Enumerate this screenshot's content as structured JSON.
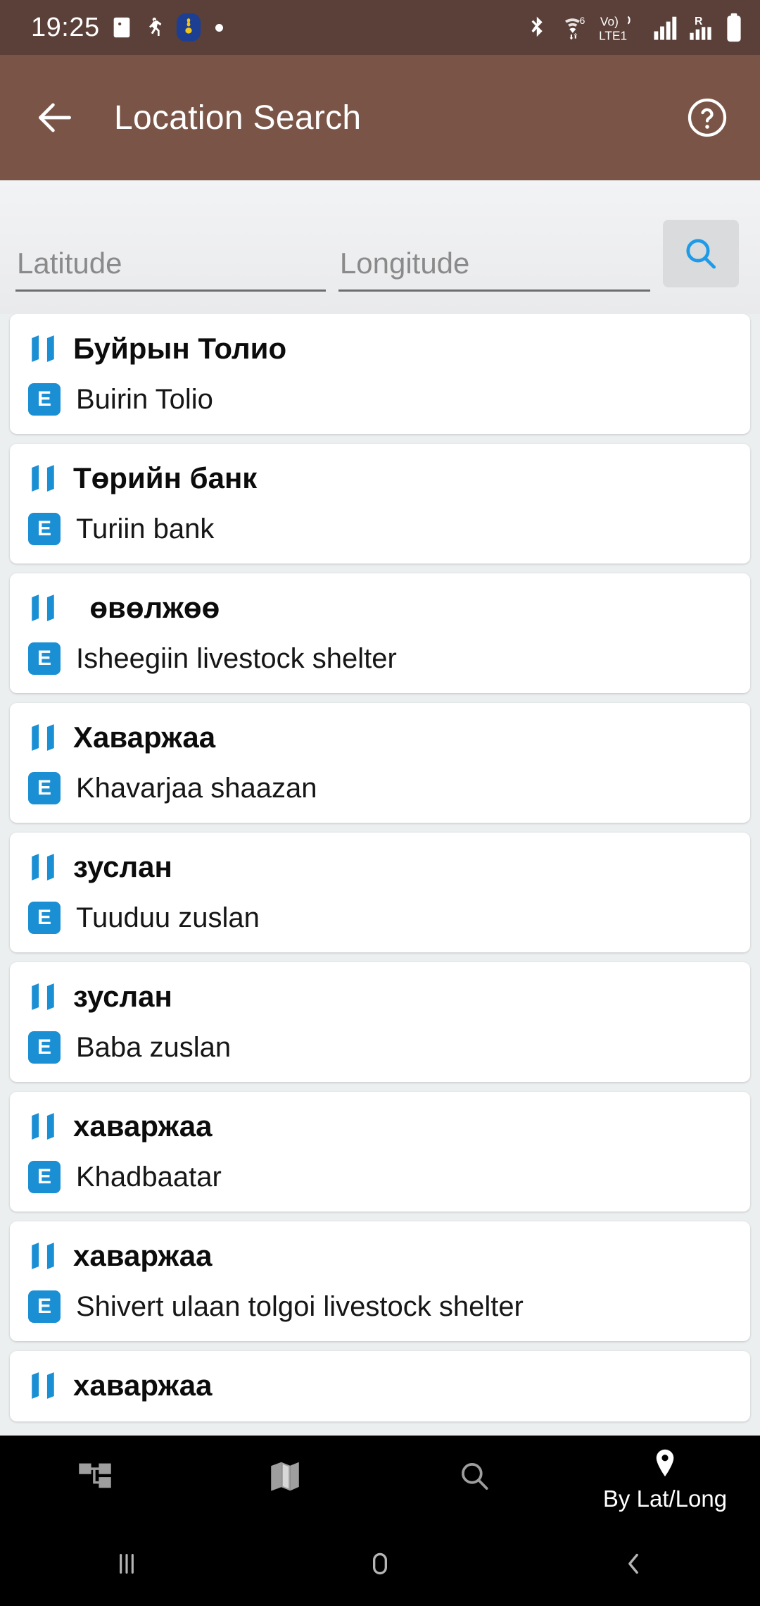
{
  "status_bar": {
    "time": "19:25",
    "left_icons": [
      "image-icon",
      "running-person-icon",
      "mongolia-app-icon",
      "dot-indicator"
    ],
    "right_icons": [
      "bluetooth-icon",
      "wifi-6-icon",
      "volte-lte1-icon",
      "signal-bars-icon",
      "roaming-signal-icon",
      "battery-icon"
    ],
    "wifi_label": "6",
    "volte_label": "Vo)",
    "network_label": "LTE1",
    "roaming_label": "R",
    "background_color": "#5a4039"
  },
  "app_bar": {
    "title": "Location Search",
    "back_label": "back-arrow",
    "help_label": "help-circle",
    "background_color": "#7a5547"
  },
  "search": {
    "latitude": {
      "placeholder": "Latitude",
      "value": ""
    },
    "longitude": {
      "placeholder": "Longitude",
      "value": ""
    },
    "button_icon": "search-icon",
    "button_color": "#d9dbdd",
    "icon_color": "#1e9be8"
  },
  "results": [
    {
      "native": "Буйрын Толио",
      "latin": "Buirin Tolio"
    },
    {
      "native": "Төрийн банк",
      "latin": "Turiin bank"
    },
    {
      "native": "  өвөлжөө",
      "latin": "Isheegiin livestock shelter"
    },
    {
      "native": "Хаваржаа",
      "latin": "Khavarjaa shaazan"
    },
    {
      "native": "зуслан",
      "latin": "Tuuduu zuslan"
    },
    {
      "native": "зуслан",
      "latin": "Baba zuslan"
    },
    {
      "native": "хаваржаа",
      "latin": "Khadbaatar"
    },
    {
      "native": "хаваржаа",
      "latin": "Shivert ulaan tolgoi livestock shelter"
    },
    {
      "native": "хаваржаа",
      "latin": ""
    }
  ],
  "bottom_nav": {
    "items": [
      {
        "icon": "hierarchy-icon",
        "label": "",
        "active": false
      },
      {
        "icon": "map-icon",
        "label": "",
        "active": false
      },
      {
        "icon": "search-icon",
        "label": "",
        "active": false
      },
      {
        "icon": "location-pin-icon",
        "label": "By Lat/Long",
        "active": true
      }
    ],
    "background_color": "#000000",
    "active_color": "#ffffff",
    "inactive_color": "#9e9e9e"
  },
  "system_nav": {
    "recents": "recents-icon",
    "home": "home-icon",
    "back": "back-icon"
  },
  "theme": {
    "accent_blue": "#1a8fd4",
    "page_background": "#eceff0",
    "card_background": "#ffffff"
  }
}
